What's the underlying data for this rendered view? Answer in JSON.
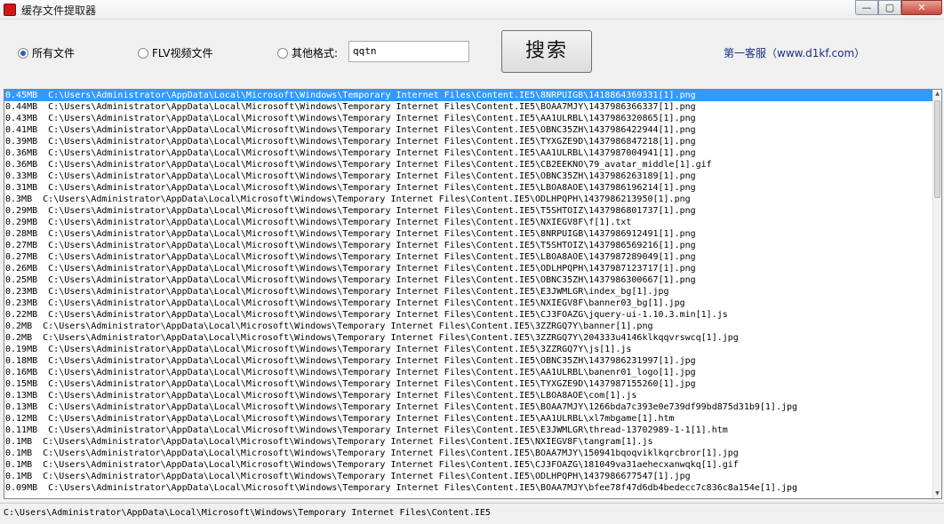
{
  "window": {
    "title": "缓存文件提取器",
    "buttons": {
      "minimize": "—",
      "maximize": "▢",
      "close": "✕"
    }
  },
  "options": {
    "all_files": "所有文件",
    "flv_files": "FLV视频文件",
    "other_formats": "其他格式:",
    "selected": "all_files"
  },
  "format_input": {
    "value": "qqtn"
  },
  "search_button": "搜索",
  "service_link": "第一客服（www.d1kf.com）",
  "file_list": {
    "selected_index": 0,
    "rows": [
      "0.45MB  C:\\Users\\Administrator\\AppData\\Local\\Microsoft\\Windows\\Temporary Internet Files\\Content.IE5\\8NRPUIGB\\1418864369331[1].png",
      "0.44MB  C:\\Users\\Administrator\\AppData\\Local\\Microsoft\\Windows\\Temporary Internet Files\\Content.IE5\\BOAA7MJY\\1437986366337[1].png",
      "0.43MB  C:\\Users\\Administrator\\AppData\\Local\\Microsoft\\Windows\\Temporary Internet Files\\Content.IE5\\AA1ULRBL\\1437986320865[1].png",
      "0.41MB  C:\\Users\\Administrator\\AppData\\Local\\Microsoft\\Windows\\Temporary Internet Files\\Content.IE5\\OBNC35ZH\\1437986422944[1].png",
      "0.39MB  C:\\Users\\Administrator\\AppData\\Local\\Microsoft\\Windows\\Temporary Internet Files\\Content.IE5\\TYXGZE9D\\1437986847218[1].png",
      "0.36MB  C:\\Users\\Administrator\\AppData\\Local\\Microsoft\\Windows\\Temporary Internet Files\\Content.IE5\\AA1ULRBL\\1437987004941[1].png",
      "0.36MB  C:\\Users\\Administrator\\AppData\\Local\\Microsoft\\Windows\\Temporary Internet Files\\Content.IE5\\CB2EEKNO\\79_avatar_middle[1].gif",
      "0.33MB  C:\\Users\\Administrator\\AppData\\Local\\Microsoft\\Windows\\Temporary Internet Files\\Content.IE5\\OBNC35ZH\\1437986263189[1].png",
      "0.31MB  C:\\Users\\Administrator\\AppData\\Local\\Microsoft\\Windows\\Temporary Internet Files\\Content.IE5\\LBOA8AOE\\1437986196214[1].png",
      "0.3MB  C:\\Users\\Administrator\\AppData\\Local\\Microsoft\\Windows\\Temporary Internet Files\\Content.IE5\\ODLHPQPH\\1437986213950[1].png",
      "0.29MB  C:\\Users\\Administrator\\AppData\\Local\\Microsoft\\Windows\\Temporary Internet Files\\Content.IE5\\T5SHTOIZ\\1437986801737[1].png",
      "0.29MB  C:\\Users\\Administrator\\AppData\\Local\\Microsoft\\Windows\\Temporary Internet Files\\Content.IE5\\NXIEGV8F\\f[1].txt",
      "0.28MB  C:\\Users\\Administrator\\AppData\\Local\\Microsoft\\Windows\\Temporary Internet Files\\Content.IE5\\8NRPUIGB\\1437986912491[1].png",
      "0.27MB  C:\\Users\\Administrator\\AppData\\Local\\Microsoft\\Windows\\Temporary Internet Files\\Content.IE5\\T5SHTOIZ\\1437986569216[1].png",
      "0.27MB  C:\\Users\\Administrator\\AppData\\Local\\Microsoft\\Windows\\Temporary Internet Files\\Content.IE5\\LBOA8AOE\\1437987289049[1].png",
      "0.26MB  C:\\Users\\Administrator\\AppData\\Local\\Microsoft\\Windows\\Temporary Internet Files\\Content.IE5\\ODLHPQPH\\1437987123717[1].png",
      "0.25MB  C:\\Users\\Administrator\\AppData\\Local\\Microsoft\\Windows\\Temporary Internet Files\\Content.IE5\\OBNC35ZH\\1437986300667[1].png",
      "0.23MB  C:\\Users\\Administrator\\AppData\\Local\\Microsoft\\Windows\\Temporary Internet Files\\Content.IE5\\E3JWMLGR\\index_bg[1].jpg",
      "0.23MB  C:\\Users\\Administrator\\AppData\\Local\\Microsoft\\Windows\\Temporary Internet Files\\Content.IE5\\NXIEGV8F\\banner03_bg[1].jpg",
      "0.22MB  C:\\Users\\Administrator\\AppData\\Local\\Microsoft\\Windows\\Temporary Internet Files\\Content.IE5\\CJ3FOAZG\\jquery-ui-1.10.3.min[1].js",
      "0.2MB  C:\\Users\\Administrator\\AppData\\Local\\Microsoft\\Windows\\Temporary Internet Files\\Content.IE5\\3ZZRGQ7Y\\banner[1].png",
      "0.2MB  C:\\Users\\Administrator\\AppData\\Local\\Microsoft\\Windows\\Temporary Internet Files\\Content.IE5\\3ZZRGQ7Y\\204333u4146klkqqvrswcq[1].jpg",
      "0.19MB  C:\\Users\\Administrator\\AppData\\Local\\Microsoft\\Windows\\Temporary Internet Files\\Content.IE5\\3ZZRGQ7Y\\js[1].js",
      "0.18MB  C:\\Users\\Administrator\\AppData\\Local\\Microsoft\\Windows\\Temporary Internet Files\\Content.IE5\\OBNC35ZH\\1437986231997[1].jpg",
      "0.16MB  C:\\Users\\Administrator\\AppData\\Local\\Microsoft\\Windows\\Temporary Internet Files\\Content.IE5\\AA1ULRBL\\banenr01_logo[1].jpg",
      "0.15MB  C:\\Users\\Administrator\\AppData\\Local\\Microsoft\\Windows\\Temporary Internet Files\\Content.IE5\\TYXGZE9D\\1437987155260[1].jpg",
      "0.13MB  C:\\Users\\Administrator\\AppData\\Local\\Microsoft\\Windows\\Temporary Internet Files\\Content.IE5\\LBOA8AOE\\com[1].js",
      "0.13MB  C:\\Users\\Administrator\\AppData\\Local\\Microsoft\\Windows\\Temporary Internet Files\\Content.IE5\\BOAA7MJY\\1266bda7c393e0e739df99bd875d31b9[1].jpg",
      "0.12MB  C:\\Users\\Administrator\\AppData\\Local\\Microsoft\\Windows\\Temporary Internet Files\\Content.IE5\\AA1ULRBL\\xl7mbgame[1].htm",
      "0.11MB  C:\\Users\\Administrator\\AppData\\Local\\Microsoft\\Windows\\Temporary Internet Files\\Content.IE5\\E3JWMLGR\\thread-13702989-1-1[1].htm",
      "0.1MB  C:\\Users\\Administrator\\AppData\\Local\\Microsoft\\Windows\\Temporary Internet Files\\Content.IE5\\NXIEGV8F\\tangram[1].js",
      "0.1MB  C:\\Users\\Administrator\\AppData\\Local\\Microsoft\\Windows\\Temporary Internet Files\\Content.IE5\\BOAA7MJY\\150941bqoqviklkqrcbror[1].jpg",
      "0.1MB  C:\\Users\\Administrator\\AppData\\Local\\Microsoft\\Windows\\Temporary Internet Files\\Content.IE5\\CJ3FOAZG\\181049va31aehecxanwqkq[1].gif",
      "0.1MB  C:\\Users\\Administrator\\AppData\\Local\\Microsoft\\Windows\\Temporary Internet Files\\Content.IE5\\ODLHPQPH\\1437986677547[1].jpg",
      "0.09MB  C:\\Users\\Administrator\\AppData\\Local\\Microsoft\\Windows\\Temporary Internet Files\\Content.IE5\\BOAA7MJY\\bfee78f47d6db4bedecc7c836c8a154e[1].jpg"
    ]
  },
  "status_bar": {
    "path": "C:\\Users\\Administrator\\AppData\\Local\\Microsoft\\Windows\\Temporary Internet Files\\Content.IE5"
  },
  "colors": {
    "selection": "#3399ff",
    "link": "#1a2f8a",
    "app_icon": "#d01818"
  },
  "icons": {
    "app": "app-icon",
    "scroll_up": "scroll-up-arrow-icon",
    "scroll_down": "scroll-down-arrow-icon"
  }
}
